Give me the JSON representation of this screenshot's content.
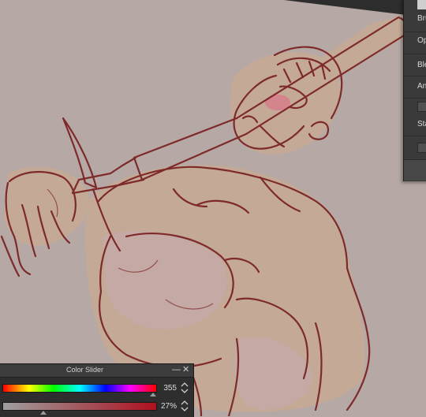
{
  "brush_panel": {
    "rows": [
      "Bru",
      "Op",
      "Ble",
      "An",
      "Sta"
    ]
  },
  "color_slider": {
    "title": "Color Slider",
    "hue_value": "355",
    "saturation_value": "27%",
    "hue_level": 0.986,
    "saturation_level": 0.27
  },
  "colors": {
    "canvas_bg": "#b5a8a5",
    "sketch_line": "#7e2a2a",
    "skin_fill": "#c8aa92",
    "panel_bg": "#2e2e2e"
  }
}
